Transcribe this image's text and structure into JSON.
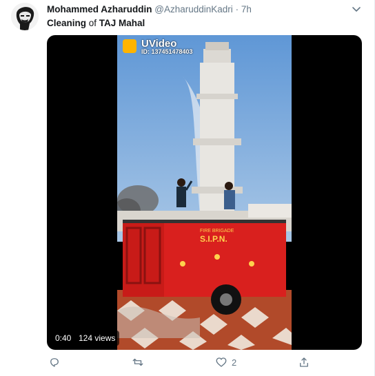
{
  "tweet": {
    "author_name": "Mohammed Azharuddin",
    "handle": "@AzharuddinKadri",
    "separator": "·",
    "time": "7h",
    "text_part1": "Cleaning",
    "text_part2": " of ",
    "text_part3": "TAJ Mahal"
  },
  "video": {
    "watermark_title": "UVideo",
    "watermark_id": "ID: 137451478403",
    "truck_label_1": "FIRE BRIGADE",
    "truck_label_2": "S.I.P.N.",
    "duration": "0:40",
    "views": "124 views"
  },
  "actions": {
    "like_count": "2"
  },
  "icons": {
    "reply": "reply-icon",
    "retweet": "retweet-icon",
    "like": "heart-icon",
    "share": "share-icon",
    "caret": "chevron-down-icon"
  },
  "colors": {
    "link_gray": "#657786",
    "truck_red": "#d9201e",
    "watermark_orange": "#ffb400"
  }
}
